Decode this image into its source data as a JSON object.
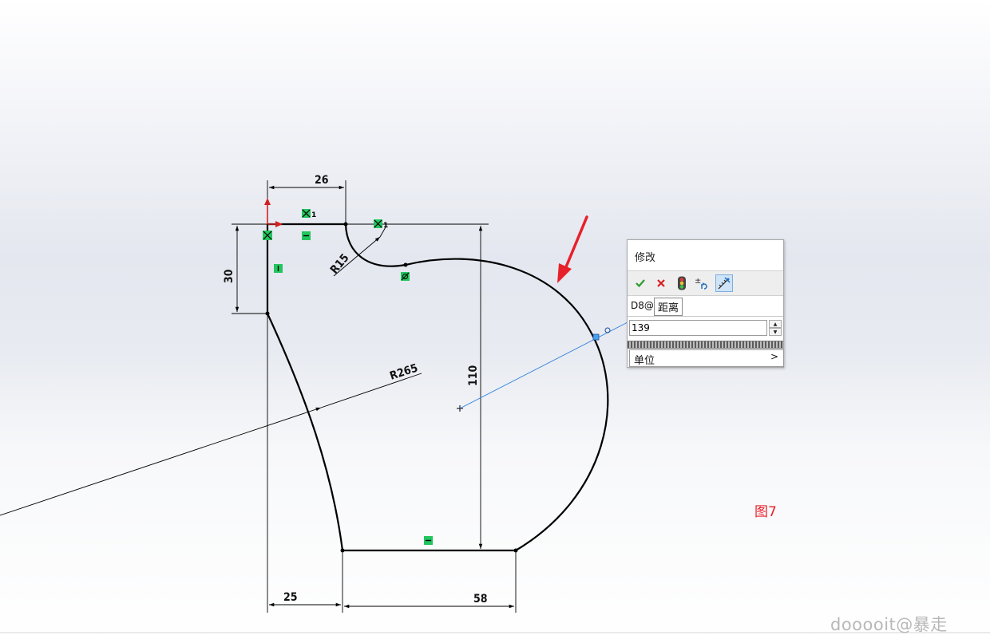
{
  "sketch": {
    "dimensions": {
      "d_top": "26",
      "d_left": "30",
      "d_radius_small": "R15",
      "d_radius_large": "R265",
      "d_height": "110",
      "d_bottom_left": "25",
      "d_bottom_right": "58"
    },
    "relation_labels": {
      "coincident_1": "1",
      "tangent_1": "1"
    }
  },
  "modify_dialog": {
    "title": "修改",
    "dimension_name": "D8@",
    "tooltip": "距离",
    "value": "139",
    "units_label": "单位",
    "units_arrow": ">",
    "buttons": {
      "ok": "check-icon",
      "cancel": "x-icon",
      "rebuild": "traffic-light-icon",
      "reverse": "reverse-sense-icon",
      "mark_for_drawing": "mark-dimension-icon"
    }
  },
  "annotation": {
    "figure_label": "图7",
    "watermark": "dooooit@暴走"
  },
  "colors": {
    "sketch_line": "#000000",
    "relation_green": "#22c55e",
    "arrow_red": "#e8202a",
    "preview_blue": "#2f7fe0"
  }
}
